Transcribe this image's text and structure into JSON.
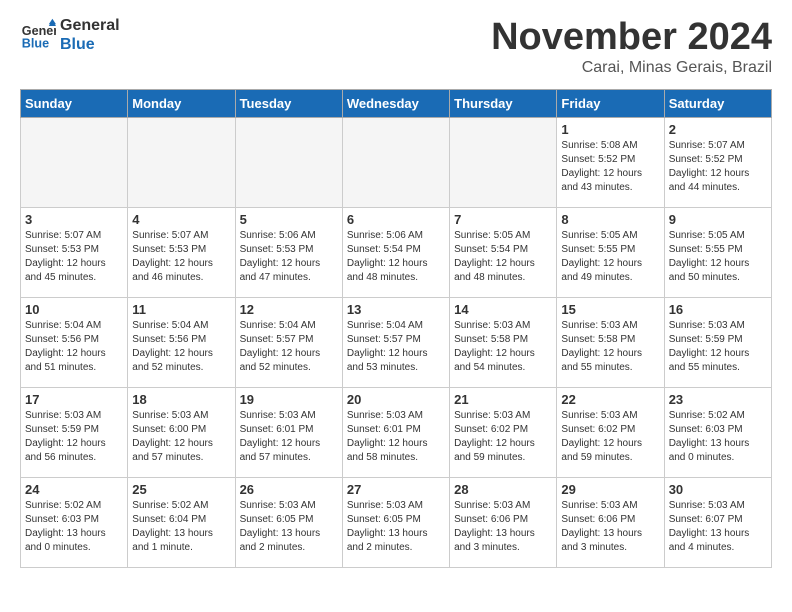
{
  "header": {
    "logo_line1": "General",
    "logo_line2": "Blue",
    "month_title": "November 2024",
    "location": "Carai, Minas Gerais, Brazil"
  },
  "days_of_week": [
    "Sunday",
    "Monday",
    "Tuesday",
    "Wednesday",
    "Thursday",
    "Friday",
    "Saturday"
  ],
  "weeks": [
    [
      {
        "day": "",
        "empty": true
      },
      {
        "day": "",
        "empty": true
      },
      {
        "day": "",
        "empty": true
      },
      {
        "day": "",
        "empty": true
      },
      {
        "day": "",
        "empty": true
      },
      {
        "day": "1",
        "info": "Sunrise: 5:08 AM\nSunset: 5:52 PM\nDaylight: 12 hours\nand 43 minutes."
      },
      {
        "day": "2",
        "info": "Sunrise: 5:07 AM\nSunset: 5:52 PM\nDaylight: 12 hours\nand 44 minutes."
      }
    ],
    [
      {
        "day": "3",
        "info": "Sunrise: 5:07 AM\nSunset: 5:53 PM\nDaylight: 12 hours\nand 45 minutes."
      },
      {
        "day": "4",
        "info": "Sunrise: 5:07 AM\nSunset: 5:53 PM\nDaylight: 12 hours\nand 46 minutes."
      },
      {
        "day": "5",
        "info": "Sunrise: 5:06 AM\nSunset: 5:53 PM\nDaylight: 12 hours\nand 47 minutes."
      },
      {
        "day": "6",
        "info": "Sunrise: 5:06 AM\nSunset: 5:54 PM\nDaylight: 12 hours\nand 48 minutes."
      },
      {
        "day": "7",
        "info": "Sunrise: 5:05 AM\nSunset: 5:54 PM\nDaylight: 12 hours\nand 48 minutes."
      },
      {
        "day": "8",
        "info": "Sunrise: 5:05 AM\nSunset: 5:55 PM\nDaylight: 12 hours\nand 49 minutes."
      },
      {
        "day": "9",
        "info": "Sunrise: 5:05 AM\nSunset: 5:55 PM\nDaylight: 12 hours\nand 50 minutes."
      }
    ],
    [
      {
        "day": "10",
        "info": "Sunrise: 5:04 AM\nSunset: 5:56 PM\nDaylight: 12 hours\nand 51 minutes."
      },
      {
        "day": "11",
        "info": "Sunrise: 5:04 AM\nSunset: 5:56 PM\nDaylight: 12 hours\nand 52 minutes."
      },
      {
        "day": "12",
        "info": "Sunrise: 5:04 AM\nSunset: 5:57 PM\nDaylight: 12 hours\nand 52 minutes."
      },
      {
        "day": "13",
        "info": "Sunrise: 5:04 AM\nSunset: 5:57 PM\nDaylight: 12 hours\nand 53 minutes."
      },
      {
        "day": "14",
        "info": "Sunrise: 5:03 AM\nSunset: 5:58 PM\nDaylight: 12 hours\nand 54 minutes."
      },
      {
        "day": "15",
        "info": "Sunrise: 5:03 AM\nSunset: 5:58 PM\nDaylight: 12 hours\nand 55 minutes."
      },
      {
        "day": "16",
        "info": "Sunrise: 5:03 AM\nSunset: 5:59 PM\nDaylight: 12 hours\nand 55 minutes."
      }
    ],
    [
      {
        "day": "17",
        "info": "Sunrise: 5:03 AM\nSunset: 5:59 PM\nDaylight: 12 hours\nand 56 minutes."
      },
      {
        "day": "18",
        "info": "Sunrise: 5:03 AM\nSunset: 6:00 PM\nDaylight: 12 hours\nand 57 minutes."
      },
      {
        "day": "19",
        "info": "Sunrise: 5:03 AM\nSunset: 6:01 PM\nDaylight: 12 hours\nand 57 minutes."
      },
      {
        "day": "20",
        "info": "Sunrise: 5:03 AM\nSunset: 6:01 PM\nDaylight: 12 hours\nand 58 minutes."
      },
      {
        "day": "21",
        "info": "Sunrise: 5:03 AM\nSunset: 6:02 PM\nDaylight: 12 hours\nand 59 minutes."
      },
      {
        "day": "22",
        "info": "Sunrise: 5:03 AM\nSunset: 6:02 PM\nDaylight: 12 hours\nand 59 minutes."
      },
      {
        "day": "23",
        "info": "Sunrise: 5:02 AM\nSunset: 6:03 PM\nDaylight: 13 hours\nand 0 minutes."
      }
    ],
    [
      {
        "day": "24",
        "info": "Sunrise: 5:02 AM\nSunset: 6:03 PM\nDaylight: 13 hours\nand 0 minutes."
      },
      {
        "day": "25",
        "info": "Sunrise: 5:02 AM\nSunset: 6:04 PM\nDaylight: 13 hours\nand 1 minute."
      },
      {
        "day": "26",
        "info": "Sunrise: 5:03 AM\nSunset: 6:05 PM\nDaylight: 13 hours\nand 2 minutes."
      },
      {
        "day": "27",
        "info": "Sunrise: 5:03 AM\nSunset: 6:05 PM\nDaylight: 13 hours\nand 2 minutes."
      },
      {
        "day": "28",
        "info": "Sunrise: 5:03 AM\nSunset: 6:06 PM\nDaylight: 13 hours\nand 3 minutes."
      },
      {
        "day": "29",
        "info": "Sunrise: 5:03 AM\nSunset: 6:06 PM\nDaylight: 13 hours\nand 3 minutes."
      },
      {
        "day": "30",
        "info": "Sunrise: 5:03 AM\nSunset: 6:07 PM\nDaylight: 13 hours\nand 4 minutes."
      }
    ]
  ]
}
